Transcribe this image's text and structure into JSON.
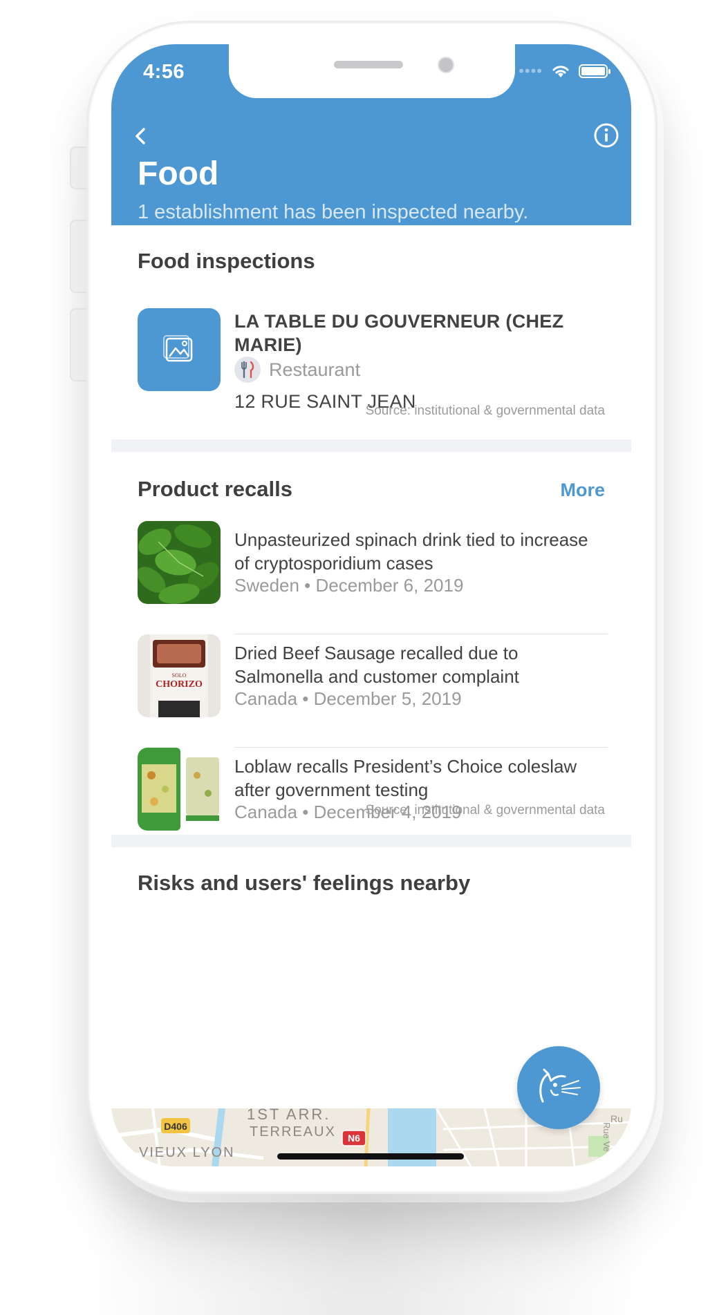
{
  "status_bar": {
    "time": "4:56"
  },
  "header": {
    "title": "Food",
    "subtitle": "1 establishment has been inspected nearby."
  },
  "food_inspections": {
    "title": "Food inspections",
    "establishment": {
      "name": "LA TABLE DU GOUVERNEUR (CHEZ MARIE)",
      "type": "Restaurant",
      "address": "12 RUE SAINT JEAN"
    },
    "source": "Source: institutional & governmental data"
  },
  "product_recalls": {
    "title": "Product recalls",
    "more_label": "More",
    "items": [
      {
        "title": "Unpasteurized spinach drink tied to increase of cryptosporidium cases",
        "meta": "Sweden • December 6, 2019"
      },
      {
        "title": "Dried Beef Sausage recalled due to Salmonella and customer complaint",
        "meta": "Canada • December 5, 2019"
      },
      {
        "title": "Loblaw recalls President’s Choice coleslaw after government testing",
        "meta": "Canada • December 4, 2019"
      }
    ],
    "source": "Source: institutional & governmental data"
  },
  "risks": {
    "title": "Risks and users' feelings nearby"
  },
  "map": {
    "labels": [
      "1ST ARR.",
      "TERREAUX",
      "VIEUX LYON",
      "D406",
      "N6",
      "Ru",
      "Rue Ve"
    ]
  },
  "product_image_text": {
    "brand": "SOLO",
    "product": "CHORIZO"
  },
  "colors": {
    "accent": "#4d97d2"
  }
}
